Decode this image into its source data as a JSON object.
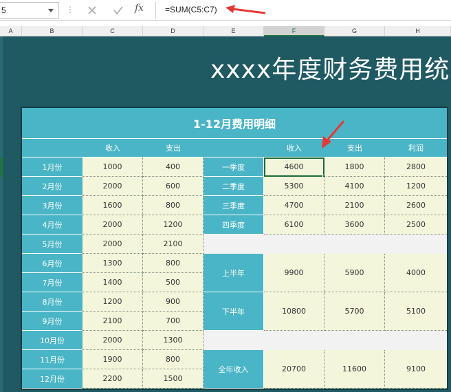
{
  "formula_bar": {
    "name_box": "5",
    "dots": "⋮",
    "cancel_icon": "close-icon",
    "enter_icon": "check-icon",
    "fx_label": "fx",
    "formula": "=SUM(C5:C7)"
  },
  "columns": [
    "A",
    "B",
    "C",
    "D",
    "E",
    "F",
    "G",
    "H"
  ],
  "selected_column": "F",
  "sheet_title": "xxxx年度财务费用统",
  "table": {
    "title": "1-12月费用明细",
    "left_headers": [
      "",
      "收入",
      "支出"
    ],
    "right_headers": [
      "",
      "收入",
      "支出",
      "利润"
    ],
    "months": [
      {
        "label": "1月份",
        "income": "1000",
        "expense": "400"
      },
      {
        "label": "2月份",
        "income": "2000",
        "expense": "600"
      },
      {
        "label": "3月份",
        "income": "1600",
        "expense": "800"
      },
      {
        "label": "4月份",
        "income": "2000",
        "expense": "1200"
      },
      {
        "label": "5月份",
        "income": "2000",
        "expense": "2100"
      },
      {
        "label": "6月份",
        "income": "1300",
        "expense": "800"
      },
      {
        "label": "7月份",
        "income": "1400",
        "expense": "500"
      },
      {
        "label": "8月份",
        "income": "1200",
        "expense": "900"
      },
      {
        "label": "9月份",
        "income": "2100",
        "expense": "700"
      },
      {
        "label": "10月份",
        "income": "2000",
        "expense": "1300"
      },
      {
        "label": "11月份",
        "income": "1900",
        "expense": "800"
      },
      {
        "label": "12月份",
        "income": "2200",
        "expense": "1500"
      }
    ],
    "quarters": [
      {
        "label": "一季度",
        "income": "4600",
        "expense": "1800",
        "profit": "2800"
      },
      {
        "label": "二季度",
        "income": "5300",
        "expense": "4100",
        "profit": "1200"
      },
      {
        "label": "三季度",
        "income": "4700",
        "expense": "2100",
        "profit": "2600"
      },
      {
        "label": "四季度",
        "income": "6100",
        "expense": "3600",
        "profit": "2500"
      }
    ],
    "halves": [
      {
        "label": "上半年",
        "income": "9900",
        "expense": "5900",
        "profit": "4000"
      },
      {
        "label": "下半年",
        "income": "10800",
        "expense": "5700",
        "profit": "5100"
      }
    ],
    "total": {
      "label": "全年收入",
      "income": "20700",
      "expense": "11600",
      "profit": "9100"
    }
  },
  "colors": {
    "sheet_bg": "#1f5a63",
    "header_cyan": "#4ab5c6",
    "value_bg": "#f4f6dc",
    "annotation_red": "#e53935",
    "selection_green": "#1e6a3a"
  }
}
